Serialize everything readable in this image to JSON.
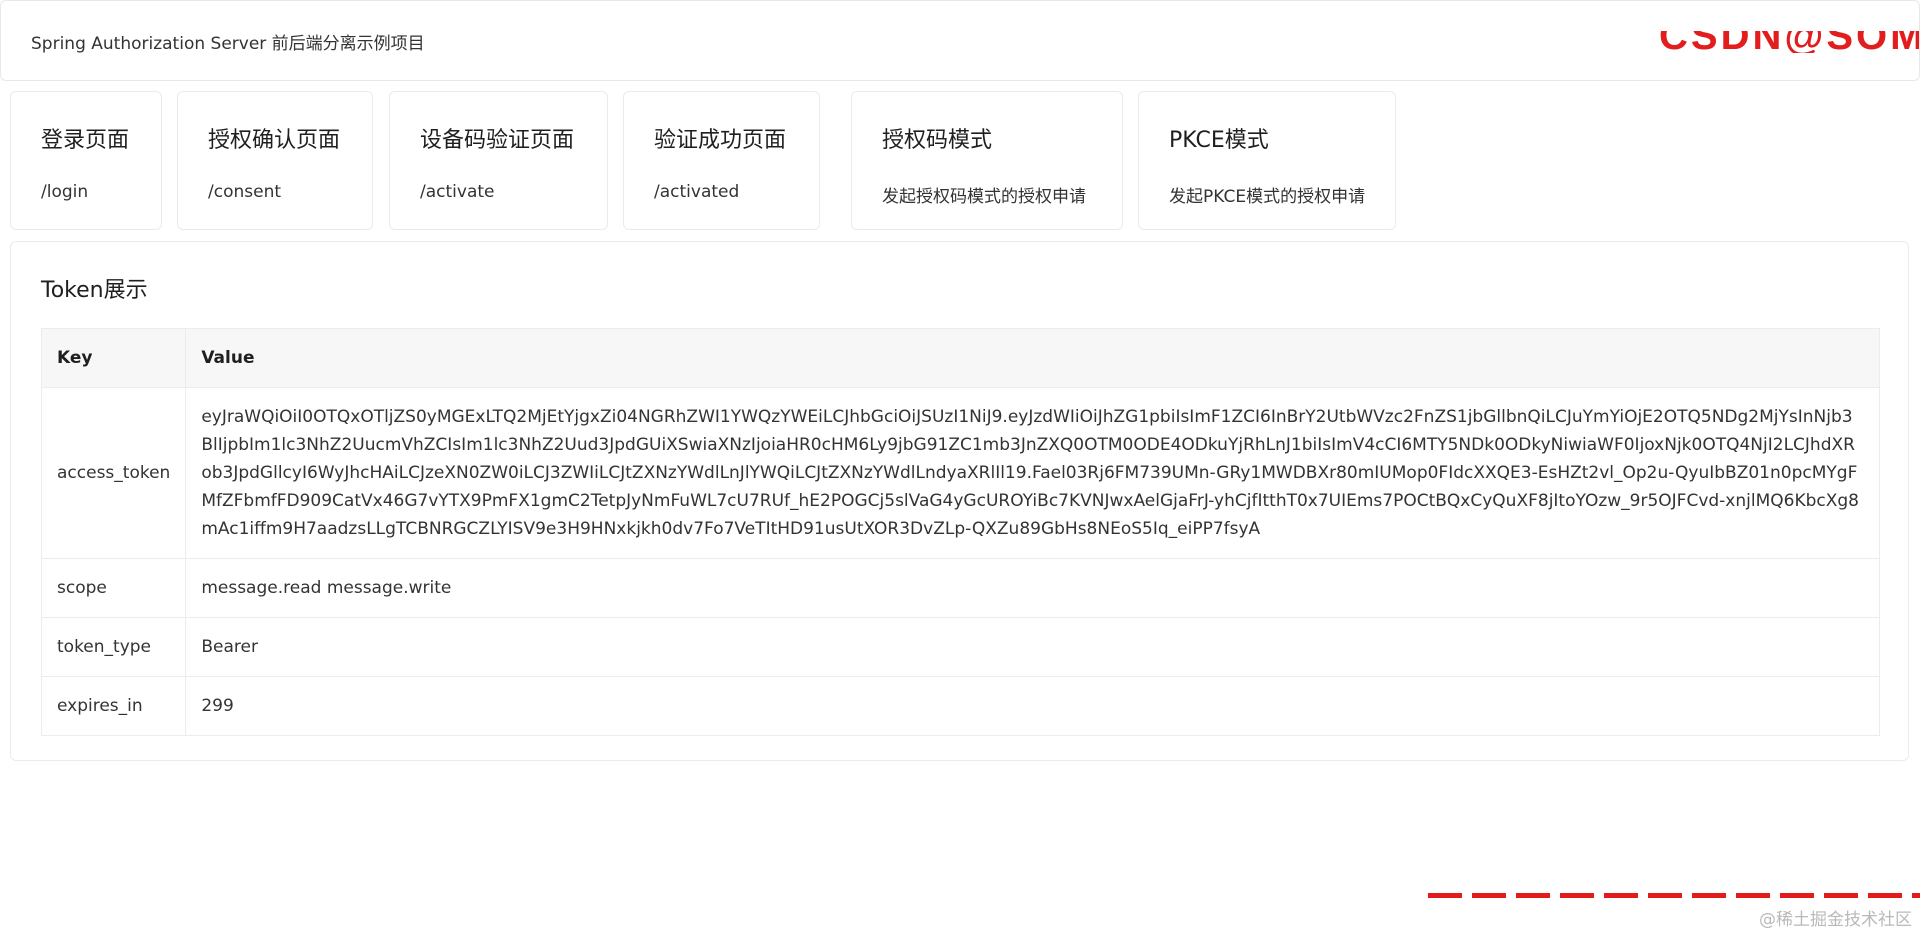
{
  "header": {
    "title": "Spring Authorization Server 前后端分离示例项目",
    "watermark_text": "CSDN@SOM"
  },
  "cards": [
    {
      "title": "登录页面",
      "desc": "/login"
    },
    {
      "title": "授权确认页面",
      "desc": "/consent"
    },
    {
      "title": "设备码验证页面",
      "desc": "/activate"
    },
    {
      "title": "验证成功页面",
      "desc": "/activated"
    },
    {
      "title": "授权码模式",
      "desc": "发起授权码模式的授权申请"
    },
    {
      "title": "PKCE模式",
      "desc": "发起PKCE模式的授权申请"
    }
  ],
  "token": {
    "title": "Token展示",
    "columns": {
      "key": "Key",
      "value": "Value"
    },
    "rows": [
      {
        "key": "access_token",
        "value": "eyJraWQiOiI0OTQxOTljZS0yMGExLTQ2MjEtYjgxZi04NGRhZWI1YWQzYWEiLCJhbGciOiJSUzI1NiJ9.eyJzdWIiOiJhZG1pbiIsImF1ZCI6InBrY2UtbWVzc2FnZS1jbGllbnQiLCJuYmYiOjE2OTQ5NDg2MjYsInNjb3BlIjpbIm1lc3NhZ2UucmVhZCIsIm1lc3NhZ2Uud3JpdGUiXSwiaXNzIjoiaHR0cHM6Ly9jbG91ZC1mb3JnZXQ0OTM0ODE4ODkuYjRhLnJ1biIsImV4cCI6MTY5NDk0ODkyNiwiaWF0IjoxNjk0OTQ4NjI2LCJhdXRob3JpdGllcyI6WyJhcHAiLCJzeXN0ZW0iLCJ3ZWIiLCJtZXNzYWdlLnJlYWQiLCJtZXNzYWdlLndyaXRlIl19.Fael03Rj6FM739UMn-GRy1MWDBXr80mIUMop0FIdcXXQE3-EsHZt2vl_Op2u-QyuIbBZ01n0pcMYgFMfZFbmfFD909CatVx46G7vYTX9PmFX1gmC2TetpJyNmFuWL7cU7RUf_hE2POGCj5slVaG4yGcUROYiBc7KVNJwxAelGjaFrJ-yhCjfItthT0x7UIEms7POCtBQxCyQuXF8jItoYOzw_9r5OJFCvd-xnjlMQ6KbcXg8mAc1iffm9H7aadzsLLgTCBNRGCZLYISV9e3H9HNxkjkh0dv7Fo7VeTItHD91usUtXOR3DvZLp-QXZu89GbHs8NEoS5Iq_eiPP7fsyA"
      },
      {
        "key": "scope",
        "value": "message.read message.write"
      },
      {
        "key": "token_type",
        "value": "Bearer"
      },
      {
        "key": "expires_in",
        "value": "299"
      }
    ]
  },
  "footer": {
    "watermark_text": "@稀土掘金技术社区"
  }
}
